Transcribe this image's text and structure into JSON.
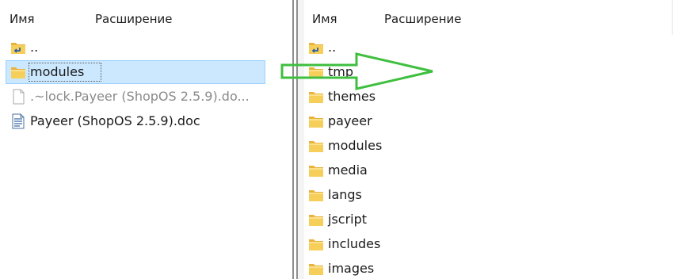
{
  "left_panel": {
    "header": {
      "name_col": "Имя",
      "ext_col": "Расширение"
    },
    "items": [
      {
        "label": "..",
        "icon": "parent-folder-icon",
        "selected": false,
        "dim": false
      },
      {
        "label": "modules",
        "icon": "folder-icon",
        "selected": true,
        "dim": false
      },
      {
        "label": ".~lock.Payeer (ShopOS 2.5.9).do...",
        "icon": "blank-file-icon",
        "selected": false,
        "dim": true
      },
      {
        "label": "Payeer (ShopOS 2.5.9).doc",
        "icon": "document-icon",
        "selected": false,
        "dim": false
      }
    ]
  },
  "right_panel": {
    "header": {
      "name_col": "Имя",
      "ext_col": "Расширение"
    },
    "items": [
      {
        "label": "..",
        "icon": "parent-folder-icon"
      },
      {
        "label": "tmp",
        "icon": "folder-icon"
      },
      {
        "label": "themes",
        "icon": "folder-icon"
      },
      {
        "label": "payeer",
        "icon": "folder-icon"
      },
      {
        "label": "modules",
        "icon": "folder-icon"
      },
      {
        "label": "media",
        "icon": "folder-icon"
      },
      {
        "label": "langs",
        "icon": "folder-icon"
      },
      {
        "label": "jscript",
        "icon": "folder-icon"
      },
      {
        "label": "includes",
        "icon": "folder-icon"
      },
      {
        "label": "images",
        "icon": "folder-icon"
      }
    ]
  },
  "annotation": {
    "arrow_color": "#3fbf3f",
    "icon": "right-arrow-icon"
  },
  "colors": {
    "selection": "#cce8ff",
    "selection_border": "#99d1ff",
    "folder": "#f3c24a"
  }
}
